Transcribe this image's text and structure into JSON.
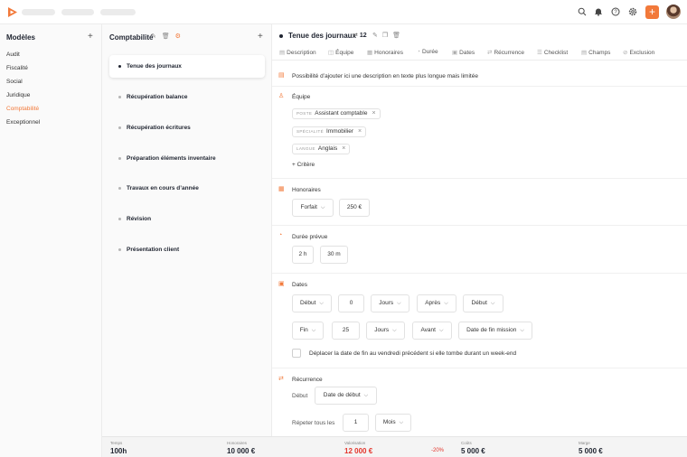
{
  "left": {
    "title": "Modèles",
    "add": "+",
    "items": [
      {
        "label": "Audit"
      },
      {
        "label": "Fiscalité"
      },
      {
        "label": "Social"
      },
      {
        "label": "Juridique"
      },
      {
        "label": "Comptabilité",
        "active": true
      },
      {
        "label": "Exceptionnel"
      }
    ]
  },
  "middle": {
    "title": "Comptabilité",
    "add": "+",
    "tasks": [
      {
        "label": "Tenue des journaux",
        "active": true
      },
      {
        "label": "Récupération balance"
      },
      {
        "label": "Récupération écritures"
      },
      {
        "label": "Préparation éléments inventaire"
      },
      {
        "label": "Travaux en cours d’année"
      },
      {
        "label": "Révision"
      },
      {
        "label": "Présentation client"
      }
    ]
  },
  "detail": {
    "title": "Tenue des journaux",
    "count": "12",
    "tabs": [
      {
        "label": "Description",
        "icon": "document-icon"
      },
      {
        "label": "Équipe",
        "icon": "team-icon"
      },
      {
        "label": "Honoraires",
        "icon": "fees-icon"
      },
      {
        "label": "Durée",
        "icon": "timer-icon"
      },
      {
        "label": "Dates",
        "icon": "calendar-icon"
      },
      {
        "label": "Récurrence",
        "icon": "recurrence-icon"
      },
      {
        "label": "Checklist",
        "icon": "checklist-icon"
      },
      {
        "label": "Champs",
        "icon": "fields-icon"
      },
      {
        "label": "Exclusion",
        "icon": "exclusion-icon"
      }
    ],
    "description": "Possibilité d’ajouter ici une description en texte plus longue mais limitée",
    "team": {
      "label": "Équipe",
      "tags": [
        {
          "key": "POSTE",
          "value": "Assistant comptable"
        },
        {
          "key": "SPÉCIALITÉ",
          "value": "Immobilier"
        },
        {
          "key": "LANGUE",
          "value": "Anglais"
        }
      ],
      "add_criterion": "+ Critère"
    },
    "fees": {
      "label": "Honoraires",
      "type": "Forfait",
      "amount": "250 €"
    },
    "duration": {
      "label": "Durée prévue",
      "hours": "2 h",
      "minutes": "30 m"
    },
    "dates": {
      "label": "Dates",
      "start_row": {
        "anchor": "Début",
        "offset": "0",
        "unit": "Jours",
        "relation": "Après",
        "reference": "Début"
      },
      "end_row": {
        "anchor": "Fin",
        "offset": "25",
        "unit": "Jours",
        "relation": "Avant",
        "reference": "Date de fin mission"
      },
      "weekend_option": "Déplacer la date de fin au vendredi précédent si elle tombe durant un week-end"
    },
    "recurrence": {
      "label": "Récurrence",
      "start_label": "Début",
      "start_value": "Date de début",
      "repeat_label": "Répeter tous les",
      "repeat_count": "1",
      "repeat_unit": "Mois"
    }
  },
  "footer": {
    "temps": {
      "label": "Temps",
      "value": "100h"
    },
    "honoraires": {
      "label": "Honoraires",
      "value": "10 000 €"
    },
    "valorisation": {
      "label": "Valorisation",
      "value": "12 000 €",
      "delta": "-20%"
    },
    "couts": {
      "label": "Coûts",
      "value": "5 000 €"
    },
    "marge": {
      "label": "Marge",
      "value": "5 000 €"
    }
  },
  "colors": {
    "accent": "#f2793a",
    "alert": "#e3352b"
  }
}
